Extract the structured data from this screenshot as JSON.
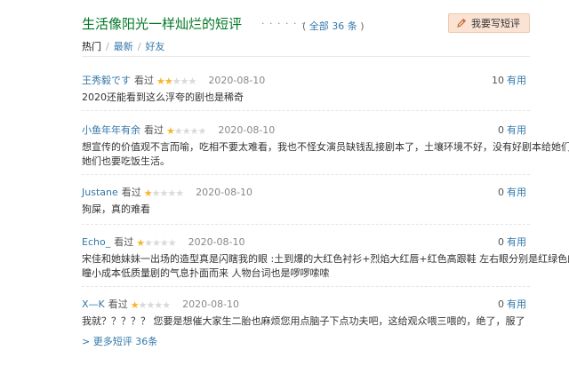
{
  "header": {
    "title": "生活像阳光一样灿烂的短评",
    "dots": "· · · · · ·",
    "all_prefix": "( ",
    "all_link": "全部 36 条",
    "all_suffix": " )",
    "write_button": "我要写短评"
  },
  "tabs": [
    {
      "label": "热门",
      "active": true
    },
    {
      "label": "最新",
      "active": false
    },
    {
      "label": "好友",
      "active": false
    }
  ],
  "tab_separator": "/",
  "watched_label": "看过",
  "useful_label": "有用",
  "reviews": [
    {
      "user": "王秀毅です",
      "rating": 2,
      "date": "2020-08-10",
      "votes": "10",
      "lines": [
        "2020还能看到这么浮夸的剧也是稀奇"
      ]
    },
    {
      "user": "小鱼年年有余",
      "rating": 1,
      "date": "2020-08-10",
      "votes": "0",
      "lines": [
        "想宣传的价值观不言而喻，吃相不要太难看，我也不怪女演员缺钱乱接剧本了，土壤环境不好，没有好剧本给她们，",
        "她们也要吃饭生活。"
      ]
    },
    {
      "user": "Justane",
      "rating": 1,
      "date": "2020-08-10",
      "votes": "0",
      "lines": [
        "狗屎，真的难看"
      ]
    },
    {
      "user": "Echo_",
      "rating": 1,
      "date": "2020-08-10",
      "votes": "0",
      "lines": [
        "宋佳和她妹妹一出场的造型真是闪瞎我的眼 :土到爆的大红色衬衫+烈焰大红唇+红色高跟鞋 左右眼分别是红绿色的美",
        "瞳小成本低质量剧的气息扑面而来 人物台词也是啰啰嗦嗦"
      ]
    },
    {
      "user": "X—K",
      "rating": 1,
      "date": "2020-08-10",
      "votes": "0",
      "lines": [
        "我就？？？？？ 您要是想催大家生二胎也麻烦您用点脑子下点功夫吧，这给观众喂三喂的，绝了，服了"
      ]
    }
  ],
  "more_link": "> 更多短评 36条",
  "colors": {
    "title": "#007722",
    "link": "#3377aa",
    "star": "#f7b52c",
    "button_bg": "#fbe3d4"
  }
}
